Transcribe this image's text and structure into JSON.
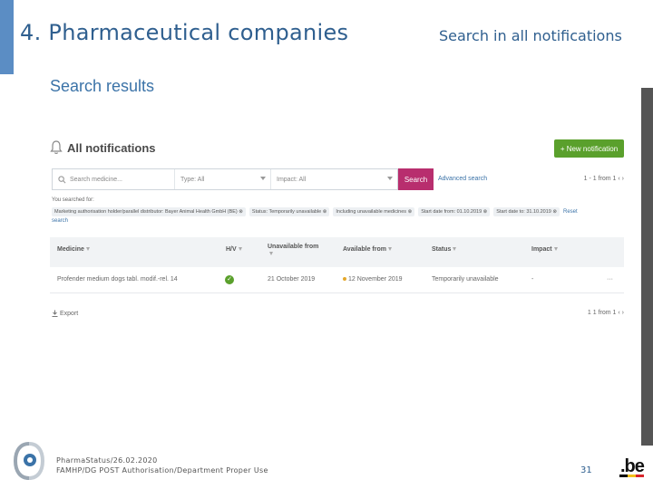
{
  "slide": {
    "title": "4. Pharmaceutical companies",
    "subtitle": "Search in all notifications",
    "section_heading": "Search results"
  },
  "app": {
    "header_title": "All notifications",
    "new_notification_label": "+ New notification",
    "search": {
      "medicine_placeholder": "Search medicine...",
      "type_value": "Type: All",
      "impact_value": "Impact: All",
      "search_button": "Search",
      "advanced_search": "Advanced search",
      "pager_top": "1 - 1 from 1  ‹  ›"
    },
    "searched_for_label": "You searched for:",
    "filter_chips": [
      "Marketing authorisation holder/parallel distributor: Bayer Animal Health GmbH (BE) ⊗",
      "Status: Temporarily unavailable ⊗",
      "Including unavailable medicines ⊗",
      "Start date from: 01.10.2019 ⊗",
      "Start date to: 31.10.2019 ⊗"
    ],
    "reset_label": "Reset",
    "reset_cont": "search",
    "table": {
      "columns": [
        "Medicine",
        "H/V",
        "Unavailable from",
        "Available from",
        "Status",
        "Impact"
      ],
      "rows": [
        {
          "medicine": "Profender medium dogs tabl. modif.-rel. 14",
          "hv": "✓",
          "unavailable_from": "21 October 2019",
          "available_from": "12 November 2019",
          "status": "Temporarily unavailable",
          "impact": "-",
          "more": "···"
        }
      ]
    },
    "export_label": "Export",
    "pager_bottom": "1   1 from 1  ‹  ›"
  },
  "footer": {
    "line1": "PharmaStatus/26.02.2020",
    "line2": "FAMHP/DG POST Authorisation/Department Proper Use",
    "page_number": "31",
    "be_logo": ".be"
  },
  "colors": {
    "accent_blue": "#2f5f8f",
    "search_button": "#b82e6e",
    "new_button": "#5aa02c",
    "belgian_flag": [
      "#000000",
      "#f4c11a",
      "#d8262c"
    ]
  }
}
